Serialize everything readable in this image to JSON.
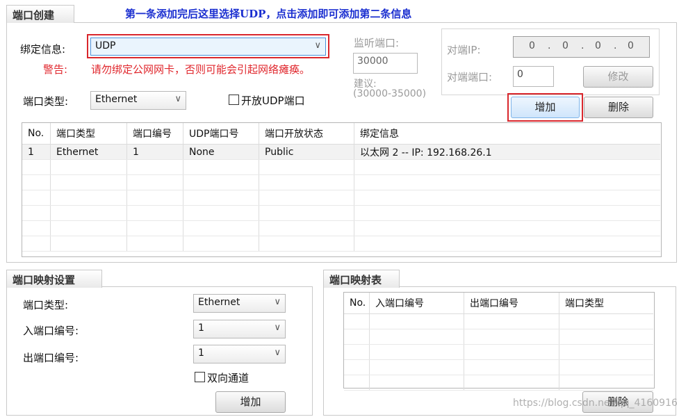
{
  "annotation": "第一条添加完后这里选择UDP，点击添加即可添加第二条信息",
  "port_create": {
    "tab": "端口创建",
    "bind_label": "绑定信息:",
    "bind_value": "UDP",
    "warn_label": "警告:",
    "warn_text": "请勿绑定公网网卡，否则可能会引起网络瘫痪。",
    "port_type_label": "端口类型:",
    "port_type_value": "Ethernet",
    "open_udp_label": "开放UDP端口",
    "listen_label": "监听端口:",
    "listen_value": "30000",
    "suggest_label": "建议:",
    "suggest_range": "(30000-35000)",
    "peer_ip_label": "对端IP:",
    "peer_ip": [
      "0",
      "0",
      "0",
      "0"
    ],
    "peer_port_label": "对端端口:",
    "peer_port_value": "0",
    "modify_button": "修改",
    "add_button": "增加",
    "delete_button": "删除",
    "table": {
      "headers": [
        "No.",
        "端口类型",
        "端口编号",
        "UDP端口号",
        "端口开放状态",
        "绑定信息"
      ],
      "rows": [
        [
          "1",
          "Ethernet",
          "1",
          "None",
          "Public",
          "以太网 2 -- IP: 192.168.26.1"
        ]
      ]
    }
  },
  "port_map_settings": {
    "tab": "端口映射设置",
    "port_type_label": "端口类型:",
    "port_type_value": "Ethernet",
    "in_port_label": "入端口编号:",
    "in_port_value": "1",
    "out_port_label": "出端口编号:",
    "out_port_value": "1",
    "bidir_label": "双向通道",
    "add_button": "增加"
  },
  "port_map_table": {
    "tab": "端口映射表",
    "headers": [
      "No.",
      "入端口编号",
      "出端口编号",
      "端口类型"
    ],
    "delete_button": "删除"
  },
  "watermark": "https://blog.csdn.net/qq_4160916"
}
